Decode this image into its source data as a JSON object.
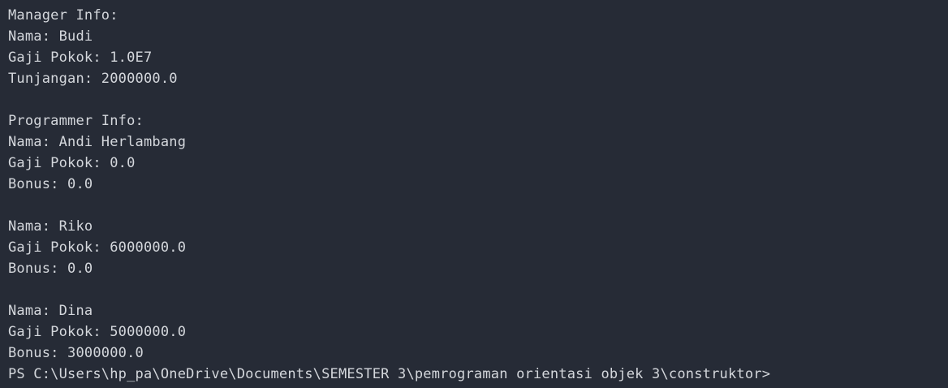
{
  "terminal": {
    "background": "#262b36",
    "foreground": "#d4d7dc",
    "manager": {
      "header": "Manager Info:",
      "nama": "Nama: Budi",
      "gaji": "Gaji Pokok: 1.0E7",
      "tunjangan": "Tunjangan: 2000000.0"
    },
    "programmer": {
      "header": "Programmer Info:",
      "entries": [
        {
          "nama": "Nama: Andi Herlambang",
          "gaji": "Gaji Pokok: 0.0",
          "bonus": "Bonus: 0.0"
        },
        {
          "nama": "Nama: Riko",
          "gaji": "Gaji Pokok: 6000000.0",
          "bonus": "Bonus: 0.0"
        },
        {
          "nama": "Nama: Dina",
          "gaji": "Gaji Pokok: 5000000.0",
          "bonus": "Bonus: 3000000.0"
        }
      ]
    },
    "prompt": "PS C:\\Users\\hp_pa\\OneDrive\\Documents\\SEMESTER 3\\pemrograman orientasi objek 3\\construktor>"
  }
}
